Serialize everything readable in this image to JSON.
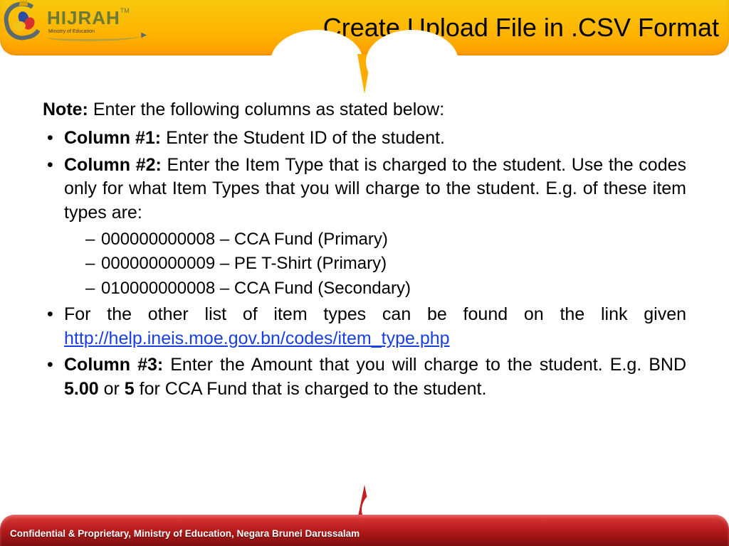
{
  "logo": {
    "word": "HIJRAH",
    "tm": "TM",
    "tagline": "Ministry of Education"
  },
  "header": {
    "title": "Create Upload File in .CSV Format"
  },
  "content": {
    "note_label": "Note:",
    "note_text": " Enter the following columns as stated below:",
    "column1": {
      "label": "Column #1:",
      "text": " Enter the Student ID of the student."
    },
    "column2": {
      "label": "Column #2:",
      "text": " Enter the Item Type that is charged to the student. Use the codes only for what Item Types that you will charge to the student. E.g. of these item types are:",
      "examples": [
        "000000000008 – CCA Fund (Primary)",
        "000000000009 – PE T-Shirt (Primary)",
        "010000000008 – CCA Fund (Secondary)"
      ]
    },
    "link_intro": "For the other list of item types can be found on the link given ",
    "link_text": "http://help.ineis.moe.gov.bn/codes/item_type.php",
    "link_href": "http://help.ineis.moe.gov.bn/codes/item_type.php",
    "column3": {
      "label": "Column #3:",
      "text_a": " Enter the Amount that you will charge to the student. E.g. BND ",
      "amount1": "5.00",
      "text_b": " or ",
      "amount2": "5",
      "text_c": " for CCA Fund that is charged to the student."
    }
  },
  "footer": {
    "text": "Confidential & Proprietary, Ministry of Education, Negara Brunei Darussalam"
  }
}
